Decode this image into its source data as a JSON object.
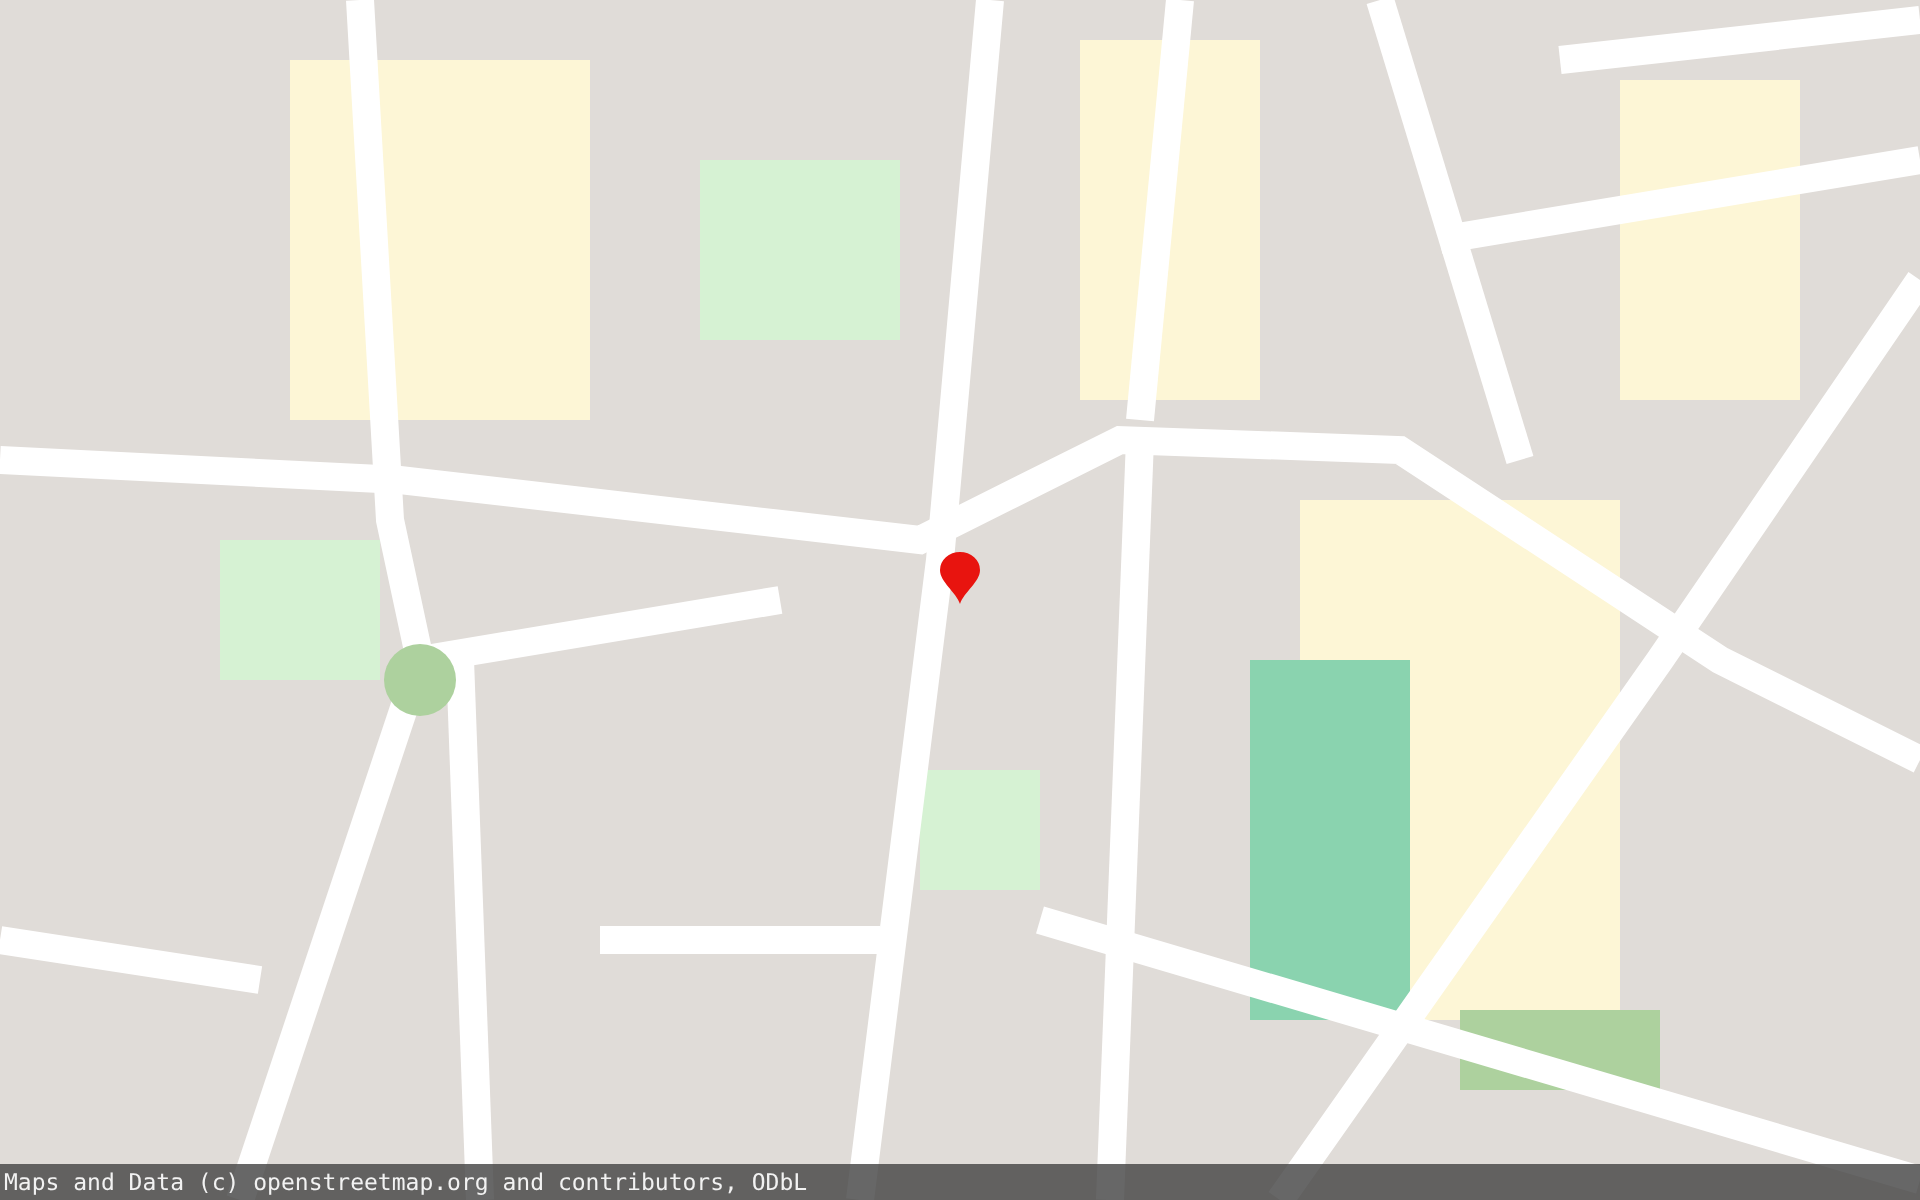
{
  "map": {
    "marker": {
      "shown": true
    }
  },
  "attribution": "Maps and Data (c) openstreetmap.org and contributors, ODbL"
}
